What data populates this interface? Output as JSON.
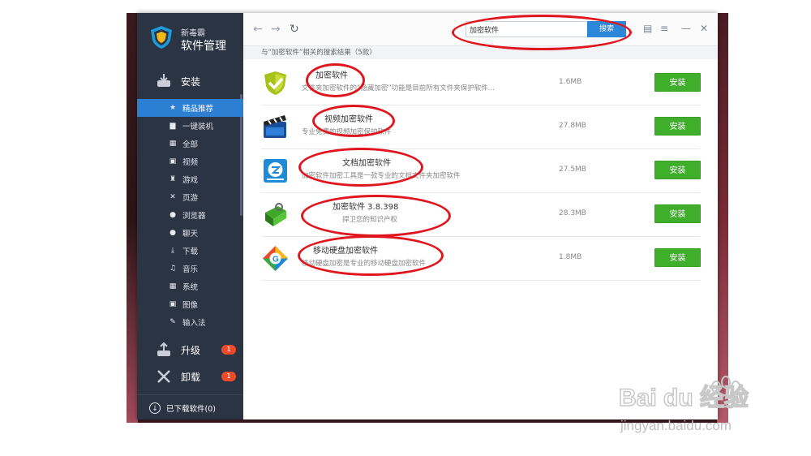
{
  "app": {
    "brand_small": "新毒霸",
    "brand_big": "软件管理"
  },
  "sidebar": {
    "install": {
      "label": "安装",
      "icon": "install-icon"
    },
    "categories": [
      {
        "label": "精品推荐",
        "icon": "star-icon",
        "glyph": "★",
        "active": true
      },
      {
        "label": "一键装机",
        "icon": "monitor-icon",
        "glyph": "▆",
        "active": false
      },
      {
        "label": "全部",
        "icon": "grid-icon",
        "glyph": "▦",
        "active": false
      },
      {
        "label": "视频",
        "icon": "video-icon",
        "glyph": "▣",
        "active": false
      },
      {
        "label": "游戏",
        "icon": "gamepad-icon",
        "glyph": "♜",
        "active": false
      },
      {
        "label": "页游",
        "icon": "swords-icon",
        "glyph": "✕",
        "active": false
      },
      {
        "label": "浏览器",
        "icon": "globe-icon",
        "glyph": "●",
        "active": false
      },
      {
        "label": "聊天",
        "icon": "chat-icon",
        "glyph": "●",
        "active": false
      },
      {
        "label": "下载",
        "icon": "download-icon",
        "glyph": "⤓",
        "active": false
      },
      {
        "label": "音乐",
        "icon": "music-icon",
        "glyph": "♫",
        "active": false
      },
      {
        "label": "系统",
        "icon": "windows-icon",
        "glyph": "▦",
        "active": false
      },
      {
        "label": "图像",
        "icon": "image-icon",
        "glyph": "▣",
        "active": false
      },
      {
        "label": "输入法",
        "icon": "pen-icon",
        "glyph": "✎",
        "active": false
      }
    ],
    "upgrade": {
      "label": "升级",
      "badge": "1",
      "icon": "upgrade-icon"
    },
    "uninstall": {
      "label": "卸载",
      "badge": "1",
      "icon": "tools-icon"
    },
    "downloaded": {
      "label": "已下载软件(0)",
      "icon": "download-circle-icon"
    }
  },
  "toolbar": {
    "search_value": "加密软件",
    "search_button": "搜索",
    "back_glyph": "←",
    "forward_glyph": "→",
    "refresh_glyph": "↻",
    "doc_glyph": "▤",
    "menu_glyph": "≡",
    "min_glyph": "—",
    "close_glyph": "✕"
  },
  "results": {
    "header": "与“加密软件”相关的搜索结果（5款）",
    "items": [
      {
        "name": "加密软件",
        "desc": "文件夹加密软件的“隐藏加密”功能是目前所有文件夹保护软件...",
        "size": "1.6MB",
        "install": "安装",
        "icon": "shield-check-icon"
      },
      {
        "name": "视频加密软件",
        "desc": "专业免费的视频加密保护软件",
        "size": "27.8MB",
        "install": "安装",
        "icon": "clapperboard-icon"
      },
      {
        "name": "文档加密软件",
        "desc": "加密软件加密工具是一款专业的文档文件夹加密软件",
        "size": "27.5MB",
        "install": "安装",
        "icon": "document-lock-icon"
      },
      {
        "name": "加密软件 3.8.398",
        "desc": "捍卫您的知识产权",
        "size": "28.3MB",
        "install": "安装",
        "icon": "green-lock-icon"
      },
      {
        "name": "移动硬盘加密软件",
        "desc": "移动硬盘加密是专业的移动硬盘加密软件",
        "size": "1.8MB",
        "install": "安装",
        "icon": "g-diamond-icon"
      }
    ]
  },
  "watermark": {
    "brand": "Bai du 经验",
    "url": "jingyan.baidu.com"
  },
  "colors": {
    "sidebar_bg": "#2b3443",
    "accent_blue": "#2d7fd4",
    "install_green": "#3fae2a",
    "badge_red": "#f04a2a",
    "annotation_red": "#e0161f"
  }
}
